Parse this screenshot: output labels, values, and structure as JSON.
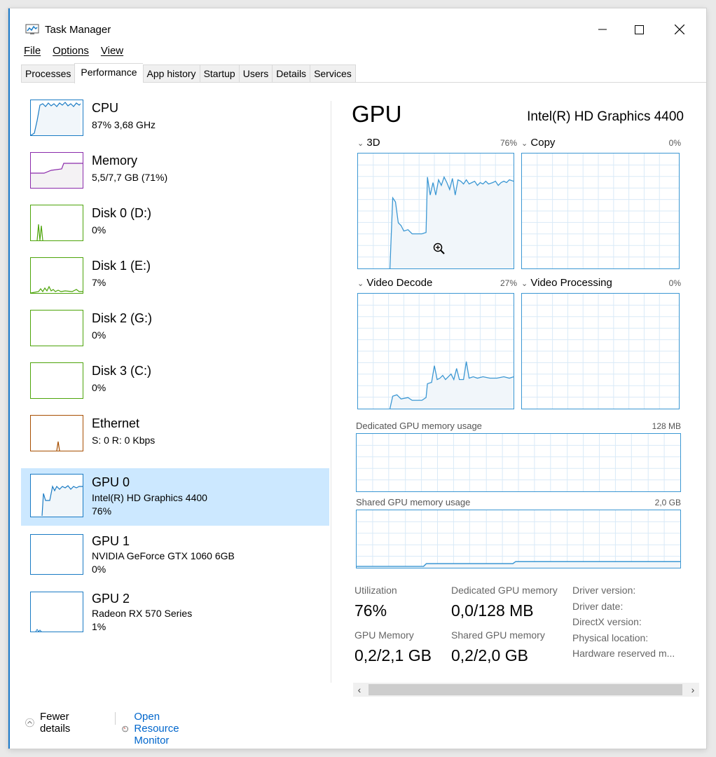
{
  "window": {
    "title": "Task Manager"
  },
  "menu": [
    "File",
    "Options",
    "View"
  ],
  "tabs": [
    "Processes",
    "Performance",
    "App history",
    "Startup",
    "Users",
    "Details",
    "Services"
  ],
  "active_tab": "Performance",
  "resources": [
    {
      "name": "CPU",
      "sub1": "87% 3,68 GHz",
      "sub2": "",
      "color": "#1a7bc4",
      "kind": "cpu"
    },
    {
      "name": "Memory",
      "sub1": "5,5/7,7 GB (71%)",
      "sub2": "",
      "color": "#8b2bab",
      "kind": "memory"
    },
    {
      "name": "Disk 0 (D:)",
      "sub1": "0%",
      "sub2": "",
      "color": "#4da40a",
      "kind": "disk"
    },
    {
      "name": "Disk 1 (E:)",
      "sub1": "7%",
      "sub2": "",
      "color": "#4da40a",
      "kind": "disk"
    },
    {
      "name": "Disk 2 (G:)",
      "sub1": "0%",
      "sub2": "",
      "color": "#4da40a",
      "kind": "disk"
    },
    {
      "name": "Disk 3 (C:)",
      "sub1": "0%",
      "sub2": "",
      "color": "#4da40a",
      "kind": "disk"
    },
    {
      "name": "Ethernet",
      "sub1": "S: 0 R: 0 Kbps",
      "sub2": "",
      "color": "#a74f01",
      "kind": "net"
    },
    {
      "name": "GPU 0",
      "sub1": "Intel(R) HD Graphics 4400",
      "sub2": "76%",
      "color": "#1a7bc4",
      "kind": "gpu",
      "selected": true
    },
    {
      "name": "GPU 1",
      "sub1": "NVIDIA GeForce GTX 1060 6GB",
      "sub2": "0%",
      "color": "#1a7bc4",
      "kind": "gpu"
    },
    {
      "name": "GPU 2",
      "sub1": "Radeon RX 570 Series",
      "sub2": "1%",
      "color": "#1a7bc4",
      "kind": "gpu"
    }
  ],
  "gpu": {
    "title": "GPU",
    "model": "Intel(R) HD Graphics 4400",
    "engines": [
      {
        "name": "3D",
        "pct": "76%"
      },
      {
        "name": "Copy",
        "pct": "0%"
      },
      {
        "name": "Video Decode",
        "pct": "27%"
      },
      {
        "name": "Video Processing",
        "pct": "0%"
      }
    ],
    "dedicated_label": "Dedicated GPU memory usage",
    "dedicated_max": "128 MB",
    "shared_label": "Shared GPU memory usage",
    "shared_max": "2,0 GB",
    "stats": {
      "utilization_label": "Utilization",
      "utilization": "76%",
      "dedicated_label": "Dedicated GPU memory",
      "dedicated": "0,0/128 MB",
      "gpu_memory_label": "GPU Memory",
      "gpu_memory": "0,2/2,1 GB",
      "shared_label": "Shared GPU memory",
      "shared": "0,2/2,0 GB"
    },
    "info_labels": [
      "Driver version:",
      "Driver date:",
      "DirectX version:",
      "Physical location:",
      "Hardware reserved m..."
    ]
  },
  "footer": {
    "fewer_details": "Fewer details",
    "open_resource_monitor": "Open Resource Monitor"
  },
  "colors": {
    "accent": "#1979ca",
    "gpu_line": "#3b97d3",
    "gpu_fill": "#f1f6fa",
    "selected_bg": "#cce8ff",
    "link": "#0066cc"
  }
}
